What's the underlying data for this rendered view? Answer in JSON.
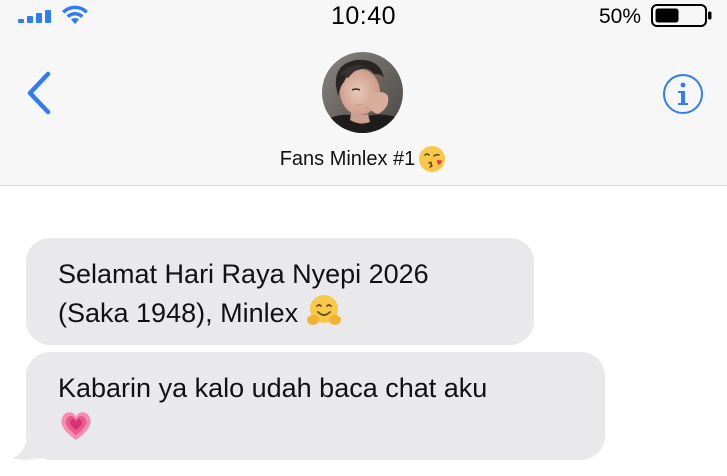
{
  "status_bar": {
    "time": "10:40",
    "battery_percent": "50%",
    "battery_level": 0.5,
    "signal_icon": "cellular-signal-icon",
    "wifi_icon": "wifi-icon"
  },
  "nav": {
    "back_icon": "chevron-left-icon",
    "info_icon": "info-circle-icon",
    "accent_color": "#2f7cf6"
  },
  "contact": {
    "name": "Fans Minlex #1",
    "name_emoji": "face-blowing-a-kiss",
    "avatar": "profile-photo"
  },
  "messages": [
    {
      "text": "Selamat Hari Raya Nyepi 2026 (Saka 1948), Minlex",
      "emoji": "hugging-face",
      "direction": "incoming"
    },
    {
      "text": "Kabarin ya kalo udah baca chat aku",
      "emoji": "growing-heart",
      "direction": "incoming"
    }
  ],
  "colors": {
    "incoming_bubble": "#e9e9ec",
    "header_background": "#f7f7f7"
  }
}
